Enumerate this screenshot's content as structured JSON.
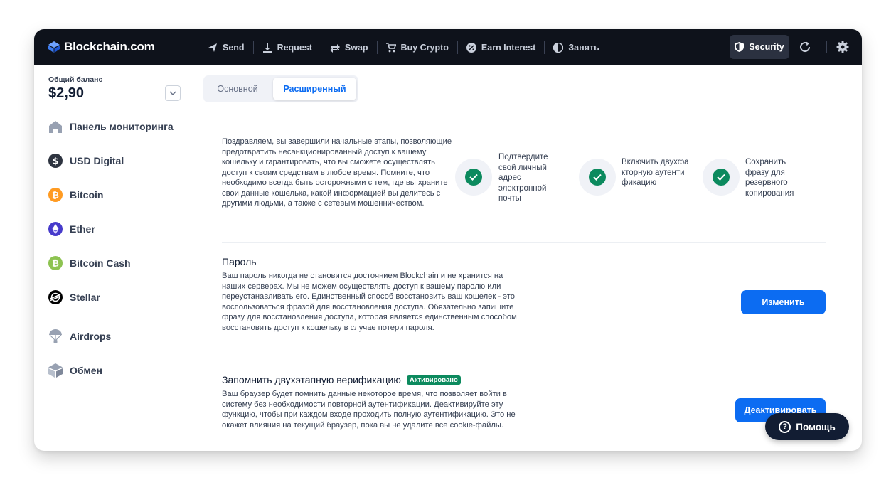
{
  "brand": {
    "name": "Blockchain.com"
  },
  "nav": {
    "items": [
      {
        "label": "Send",
        "icon": "send-icon"
      },
      {
        "label": "Request",
        "icon": "download-icon"
      },
      {
        "label": "Swap",
        "icon": "swap-icon"
      },
      {
        "label": "Buy Crypto",
        "icon": "cart-icon"
      },
      {
        "label": "Earn Interest",
        "icon": "percent-icon"
      },
      {
        "label": "Занять",
        "icon": "borrow-icon"
      }
    ],
    "security_label": "Security"
  },
  "sidebar": {
    "balance_label": "Общий баланс",
    "balance_value": "$2,90",
    "items": [
      {
        "label": "Панель мониторинга",
        "icon": "home-icon"
      },
      {
        "label": "USD Digital",
        "icon": "usd-digital-icon",
        "color": "#2e3440"
      },
      {
        "label": "Bitcoin",
        "icon": "bitcoin-icon",
        "color": "#ff9b22"
      },
      {
        "label": "Ether",
        "icon": "ether-icon",
        "color": "#473bcb"
      },
      {
        "label": "Bitcoin Cash",
        "icon": "bitcoin-cash-icon",
        "color": "#8dc351"
      },
      {
        "label": "Stellar",
        "icon": "stellar-icon",
        "color": "#000000"
      }
    ],
    "extra_items": [
      {
        "label": "Airdrops",
        "icon": "parachute-icon"
      },
      {
        "label": "Обмен",
        "icon": "exchange-icon"
      }
    ]
  },
  "tabs": {
    "basic": "Основной",
    "advanced": "Расширенный"
  },
  "intro": {
    "text": "Поздравляем, вы завершили начальные этапы, позволяющие предотвратить несанкционированный доступ к вашему кошельку и гарантировать, что вы сможете осуществлять доступ к своим средствам в любое время. Помните, что необходимо всегда быть осторожными с тем, где вы храните свои данные кошелька, какой информацией вы делитесь с другими людьми, а также с сетевым мошенничеством.",
    "checks": [
      "Подтвердите свой личный адрес электронной почты",
      "Включить двухфакторную аутентификацию",
      "Сохранить фразу для резервного копирования"
    ]
  },
  "password": {
    "title": "Пароль",
    "description": "Ваш пароль никогда не становится достоянием Blockchain и не хранится на наших серверах. Мы не можем осуществлять доступ к вашему паролю или переустанавливать его. Единственный способ восстановить ваш кошелек - это воспользоваться фразой для восстановления доступа. Обязательно запишите фразу для восстановления доступа, которая является единственным способом восстановить доступ к кошельку в случае потери пароля.",
    "button": "Изменить"
  },
  "two_step": {
    "title": "Запомнить двухэтапную верификацию",
    "badge": "Активировано",
    "description": "Ваш браузер будет помнить данные некоторое время, что позволяет войти в систему без необходимости повторной аутентификации. Деактивируйте эту функцию, чтобы при каждом входе проходить полную аутентификацию. Это не окажет влияния на текущий браузер, пока вы не удалите все cookie-файлы.",
    "button": "Деактивировать"
  },
  "help": {
    "label": "Помощь"
  },
  "colors": {
    "accent": "#0c6cf2",
    "success": "#0c8a5e",
    "nav_bg": "#0e121b"
  }
}
